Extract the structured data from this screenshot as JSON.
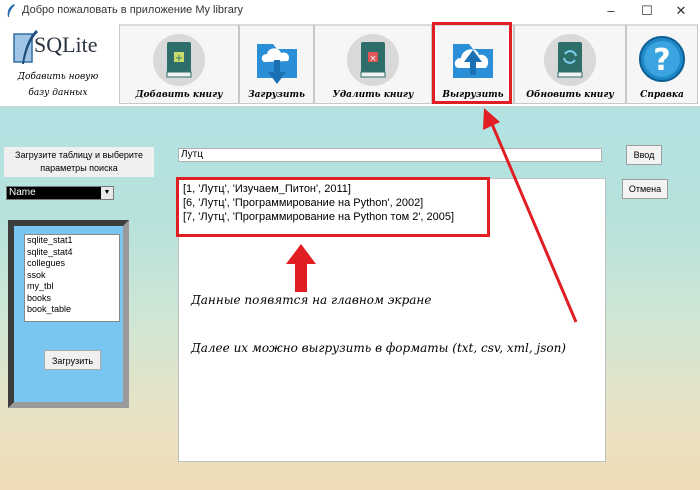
{
  "window": {
    "title": "Добро пожаловать в приложение My library"
  },
  "logo": {
    "db_word": "SQLite",
    "line1": "Добавить новую",
    "line2": "базу данных"
  },
  "toolbar": {
    "buttons": [
      {
        "label": "Добавить книгу",
        "icon": "book-add-icon"
      },
      {
        "label": "Загрузить",
        "icon": "cloud-download-icon"
      },
      {
        "label": "Удалить книгу",
        "icon": "book-delete-icon"
      },
      {
        "label": "Выгрузить",
        "icon": "cloud-upload-icon"
      },
      {
        "label": "Обновить книгу",
        "icon": "book-refresh-icon"
      },
      {
        "label": "Справка",
        "icon": "help-icon"
      }
    ]
  },
  "left": {
    "prompt": "Загрузите таблицу и выберите параметры поиска",
    "field_select": "Name",
    "tables": [
      "sqlite_stat1",
      "sqlite_stat4",
      "collegues",
      "ssok",
      "my_tbl",
      "books",
      "book_table"
    ],
    "load_label": "Загрузить"
  },
  "search": {
    "value": "Лутц",
    "enter_label": "Ввод",
    "cancel_label": "Отмена"
  },
  "results": {
    "rows": [
      "[1, 'Лутц', 'Изучаем_Питон', 2011]",
      "[6, 'Лутц', 'Программирование на Python', 2002]",
      "[7, 'Лутц', 'Программирование на Python том 2', 2005]"
    ],
    "note1": "Данные появятся на главном экране",
    "note2": "Далее их можно выгрузить в форматы (txt, csv, xml, json)"
  },
  "colors": {
    "accent_red": "#e01e24",
    "panel_blue": "#79c6f0",
    "book_green": "#2d6e6a"
  }
}
